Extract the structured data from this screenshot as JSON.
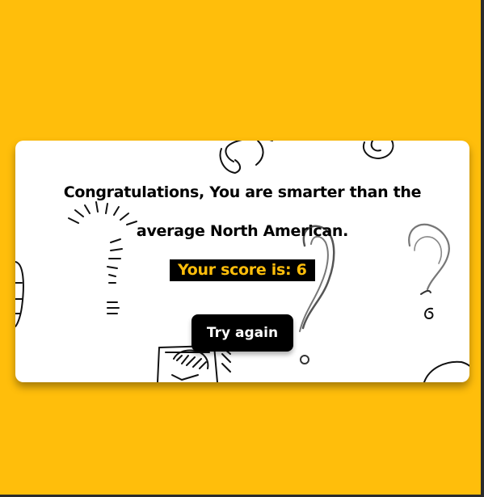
{
  "colors": {
    "background": "#FFBE0B",
    "card": "#FFFFFF",
    "accent_text": "#FFBE0B",
    "button": "#000000"
  },
  "result": {
    "message": "Congratulations, You are smarter than the average North American.",
    "score_label": "Your score is: 6",
    "score": 6
  },
  "actions": {
    "try_again_label": "Try again"
  },
  "decorations": {
    "pattern_icon": "question-mark-doodle-pattern"
  }
}
